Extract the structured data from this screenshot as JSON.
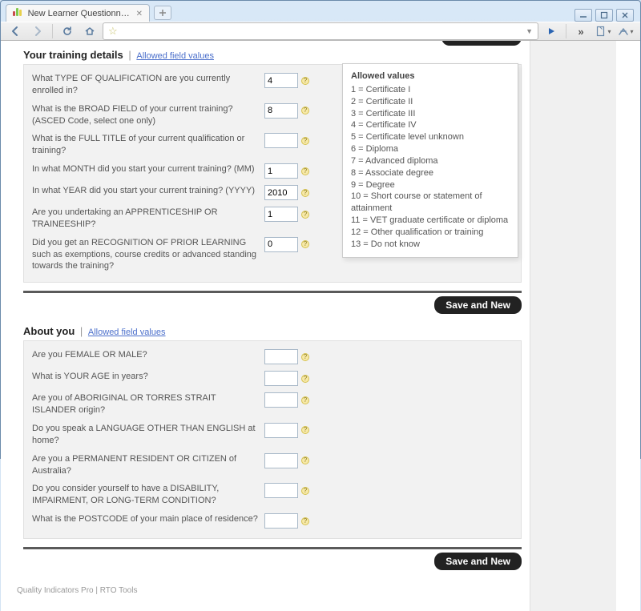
{
  "browser": {
    "tab_title": "New Learner Questionnaire...",
    "url": ""
  },
  "section1": {
    "title": "Your training details",
    "link": "Allowed field values",
    "rows": [
      {
        "label": "What TYPE OF QUALIFICATION are you currently enrolled in?",
        "value": "4"
      },
      {
        "label": "What is the BROAD FIELD of your current training? (ASCED Code, select one only)",
        "value": "8"
      },
      {
        "label": "What is the FULL TITLE of your current qualification or training?",
        "value": ""
      },
      {
        "label": "In what MONTH did you start your current training? (MM)",
        "value": "1"
      },
      {
        "label": "In what YEAR did you start your current training? (YYYY)",
        "value": "2010"
      },
      {
        "label": "Are you undertaking an APPRENTICESHIP OR TRAINEESHIP?",
        "value": "1"
      },
      {
        "label": "Did you get an RECOGNITION OF PRIOR LEARNING such as exemptions, course credits or advanced standing towards the training?",
        "value": "0"
      }
    ]
  },
  "section2": {
    "title": "About you",
    "link": "Allowed field values",
    "rows": [
      {
        "label": "Are you FEMALE OR MALE?",
        "value": ""
      },
      {
        "label": "What is YOUR AGE in years?",
        "value": ""
      },
      {
        "label": "Are you of ABORIGINAL OR TORRES STRAIT ISLANDER origin?",
        "value": ""
      },
      {
        "label": "Do you speak a LANGUAGE OTHER THAN ENGLISH at home?",
        "value": ""
      },
      {
        "label": "Are you a PERMANENT RESIDENT OR CITIZEN of Australia?",
        "value": ""
      },
      {
        "label": "Do you consider yourself to have a DISABILITY, IMPAIRMENT, OR LONG-TERM CONDITION?",
        "value": ""
      },
      {
        "label": "What is the POSTCODE of your main place of residence?",
        "value": ""
      }
    ]
  },
  "tooltip": {
    "title": "Allowed values",
    "lines": [
      "1 = Certificate I",
      "2 = Certificate II",
      "3 = Certificate III",
      "4 = Certificate IV",
      "5 = Certificate level unknown",
      "6 = Diploma",
      "7 = Advanced diploma",
      "8 = Associate degree",
      "9 = Degree",
      "10 = Short course or statement of attainment",
      "11 = VET graduate certificate or diploma",
      "12 = Other qualification or training",
      "13 = Do not know"
    ]
  },
  "buttons": {
    "save": "Save and New"
  },
  "footer": "Quality Indicators Pro | RTO Tools"
}
